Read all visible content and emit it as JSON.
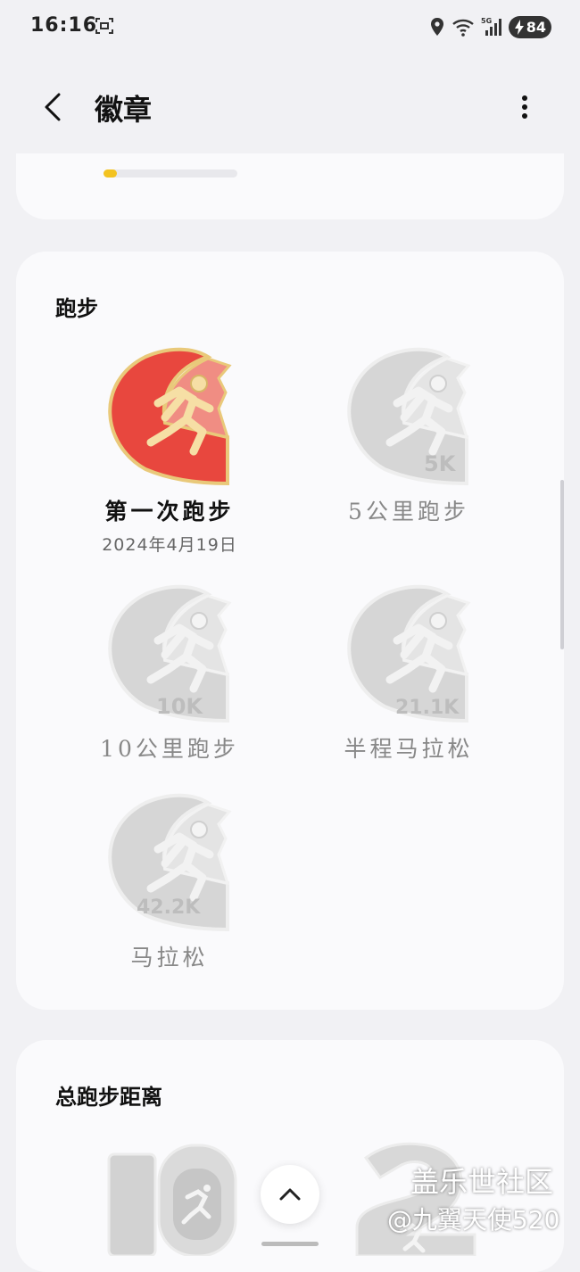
{
  "status_bar": {
    "time": "16:16",
    "battery": "84"
  },
  "header": {
    "title": "徽章"
  },
  "progress": {
    "level": 0.1,
    "color": "#f3c321"
  },
  "running": {
    "title": "跑步",
    "badges": [
      {
        "name": "第一次跑步",
        "date": "2024年4月19日",
        "earned": true
      },
      {
        "name": "5公里跑步",
        "label": "5K",
        "earned": false
      },
      {
        "name": "10公里跑步",
        "label": "10K",
        "earned": false
      },
      {
        "name": "半程马拉松",
        "label": "21.1K",
        "earned": false
      },
      {
        "name": "马拉松",
        "label": "42.2K",
        "earned": false
      }
    ]
  },
  "distance": {
    "title": "总跑步距离"
  },
  "watermark": {
    "brand": "盖乐世社区",
    "user": "@九翼天使520"
  },
  "colors": {
    "earned_red": "#e8473e",
    "gold": "#e9c97a",
    "locked": "#cfcfcf"
  }
}
